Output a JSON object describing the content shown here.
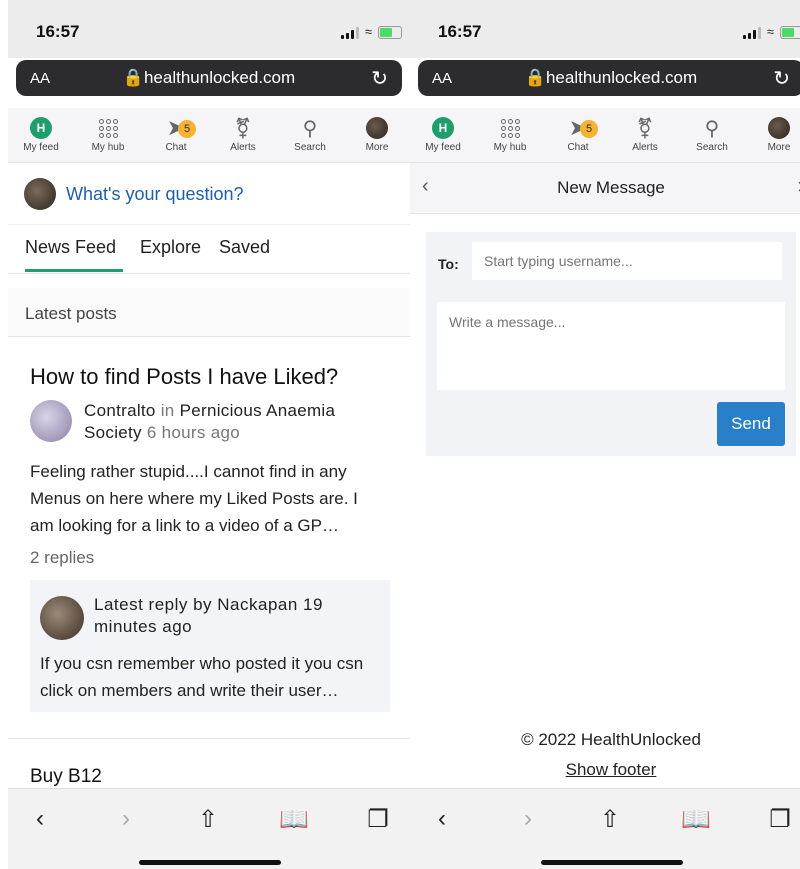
{
  "left": {
    "status": {
      "time": "16:57"
    },
    "browser": {
      "text_size": "AA",
      "url": "healthunlocked.com"
    },
    "nav": [
      {
        "label": "My feed",
        "icon": "avatar-h-icon"
      },
      {
        "label": "My hub",
        "icon": "grid-icon"
      },
      {
        "label": "Chat",
        "icon": "paper-plane-icon",
        "badge": "5"
      },
      {
        "label": "Alerts",
        "icon": "bell-icon"
      },
      {
        "label": "Search",
        "icon": "search-icon"
      },
      {
        "label": "More",
        "icon": "avatar-icon"
      }
    ],
    "question_prompt": "What's your question?",
    "feed_tabs": [
      "News Feed",
      "Explore",
      "Saved"
    ],
    "section_title": "Latest posts",
    "post": {
      "title": "How to find Posts I have Liked?",
      "author": "Contralto",
      "in_word": "in",
      "community": "Pernicious Anaemia Society",
      "time": "6 hours ago",
      "excerpt": "Feeling rather stupid....I cannot find in any Menus on here where my Liked Posts are. I am looking for a link to a video of a GP…",
      "replies": "2 replies",
      "latest_reply": {
        "heading": "Latest reply by Nackapan 19 minutes ago",
        "text": "If you csn remember who posted it you csn click on members and write their user…"
      }
    },
    "next_post_title": "Buy B12"
  },
  "right": {
    "status": {
      "time": "16:57"
    },
    "browser": {
      "text_size": "AA",
      "url": "healthunlocked.com"
    },
    "nav": [
      {
        "label": "My feed"
      },
      {
        "label": "My hub"
      },
      {
        "label": "Chat",
        "badge": "5"
      },
      {
        "label": "Alerts"
      },
      {
        "label": "Search"
      },
      {
        "label": "More"
      }
    ],
    "new_message": {
      "title": "New Message",
      "to_label": "To:",
      "to_placeholder": "Start typing username...",
      "message_placeholder": "Write a message...",
      "send_label": "Send"
    },
    "footer": {
      "copyright": "© 2022 HealthUnlocked",
      "show_footer": "Show footer"
    }
  },
  "colors": {
    "brand_green": "#1e9e6b",
    "link_blue": "#1e5fa8",
    "send_blue": "#2a7fc9",
    "badge_yellow": "#f5b335"
  }
}
